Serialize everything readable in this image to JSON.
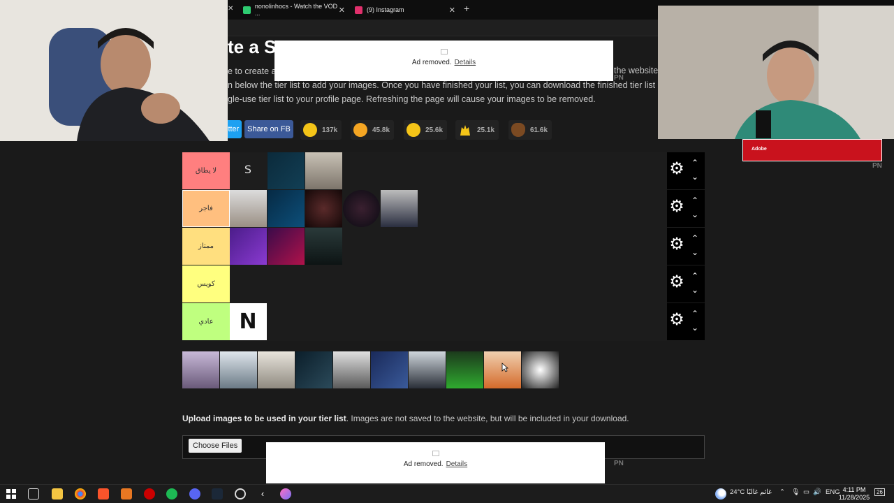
{
  "browser": {
    "tabs": [
      {
        "title": "nonolinhocs - Watch the VOD ...",
        "color": "#2ecc71"
      },
      {
        "title": "(9) Instagram",
        "color": "#e1306c"
      }
    ],
    "new_tab": "+"
  },
  "page": {
    "title_fragment": "te a S",
    "intro_lines": [
      "e to create a s",
      "n below the tier list to add your images. Once you have finished your list, you can download the finished tier list image. It is",
      "gle-use tier list to your profile page. Refreshing the page will cause your images to be removed."
    ],
    "intro_tail": "the website.",
    "ads": [
      {
        "text": "Ad removed.",
        "link": "Details"
      },
      {
        "text": "Ad removed.",
        "link": "Details"
      }
    ],
    "pn_label": "PN",
    "share": {
      "twitter": "itter",
      "facebook": "Share on FB"
    },
    "reactions": [
      {
        "icon": "smile-emoji-icon",
        "count": "137k"
      },
      {
        "icon": "heart-eyes-emoji-icon",
        "count": "45.8k"
      },
      {
        "icon": "laugh-emoji-icon",
        "count": "25.6k"
      },
      {
        "icon": "raised-hands-emoji-icon",
        "count": "25.1k"
      },
      {
        "icon": "poop-emoji-icon",
        "count": "61.6k"
      }
    ],
    "tiers": [
      {
        "label": "لا يطاق",
        "color": "#ff7f7f",
        "items": 3
      },
      {
        "label": "فاجر",
        "color": "#ffbf7f",
        "items": 5
      },
      {
        "label": "ممتاز",
        "color": "#ffdf7f",
        "items": 3
      },
      {
        "label": "كويس",
        "color": "#ffff7f",
        "items": 0
      },
      {
        "label": "عادي",
        "color": "#bfff7f",
        "items": 1
      }
    ],
    "pool_count": 10,
    "upload": {
      "bold": "Upload images to be used in your tier list",
      "rest": ". Images are not saved to the website, but will be included in your download.",
      "choose_label": "Choose Files"
    }
  },
  "overlay": {
    "brand": "Adobe"
  },
  "taskbar": {
    "weather": "24°C",
    "weather_text": "غائم غالبًا",
    "lang": "ENG",
    "time": "4:11 PM",
    "date": "11/28/2025",
    "notif_count": "26"
  }
}
